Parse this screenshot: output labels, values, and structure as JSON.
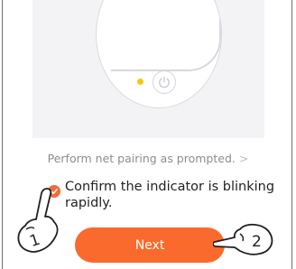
{
  "illustration": {
    "indicator_color": "#f5c518",
    "power_icon": "power-icon"
  },
  "hint": {
    "text": "Perform net pairing as prompted.",
    "chevron": ">"
  },
  "confirm": {
    "checked": true,
    "text_line1": "Confirm the indicator is blinking",
    "text_line2": "rapidly."
  },
  "next_button": {
    "label": "Next",
    "color": "#fa6a2c"
  },
  "annotations": {
    "hand_1_number": "1",
    "hand_2_number": "2"
  }
}
